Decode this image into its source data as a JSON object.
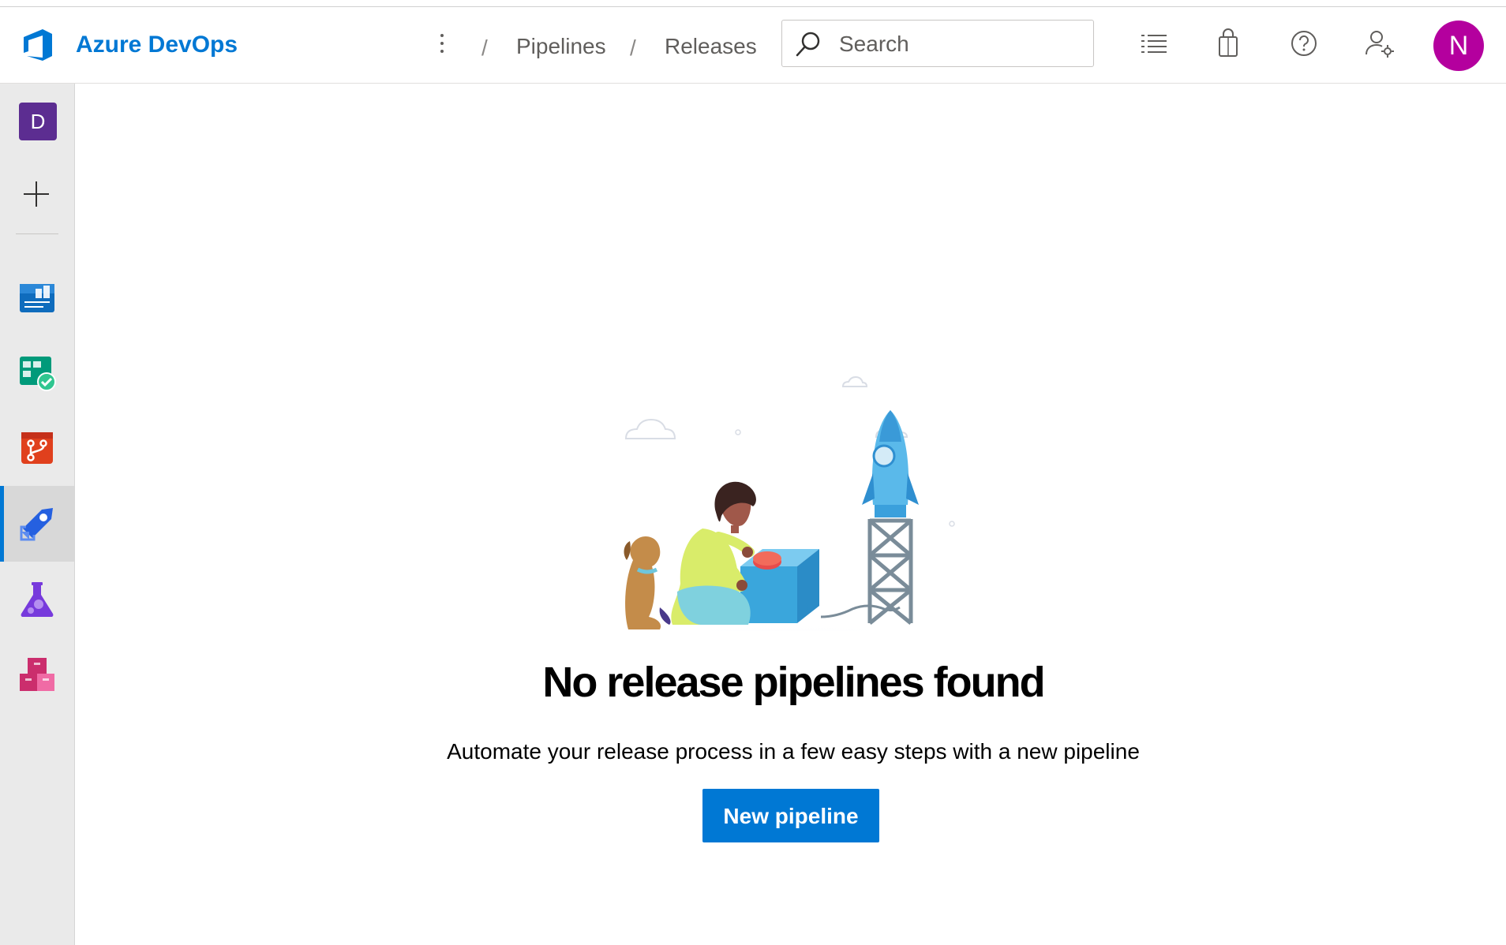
{
  "header": {
    "brand": "Azure DevOps",
    "breadcrumb": [
      {
        "label": "Pipelines"
      },
      {
        "label": "Releases"
      }
    ],
    "search": {
      "placeholder": "Search"
    },
    "avatar_initial": "N",
    "avatar_color": "#b4009e",
    "icons": [
      "more-vertical-icon",
      "task-list-icon",
      "marketplace-bag-icon",
      "help-icon",
      "user-settings-icon"
    ]
  },
  "sidebar": {
    "org_initial": "D",
    "org_color": "#5c2d91",
    "items": [
      {
        "name": "overview",
        "icon": "overview-icon"
      },
      {
        "name": "boards",
        "icon": "boards-icon"
      },
      {
        "name": "repos",
        "icon": "repos-icon"
      },
      {
        "name": "pipelines",
        "icon": "pipelines-icon",
        "active": true
      },
      {
        "name": "test-plans",
        "icon": "test-plans-icon"
      },
      {
        "name": "artifacts",
        "icon": "artifacts-icon"
      }
    ]
  },
  "empty_state": {
    "title": "No release pipelines found",
    "subtitle": "Automate your release process in a few easy steps with a new pipeline",
    "button_label": "New pipeline"
  },
  "colors": {
    "accent": "#0078d4"
  }
}
